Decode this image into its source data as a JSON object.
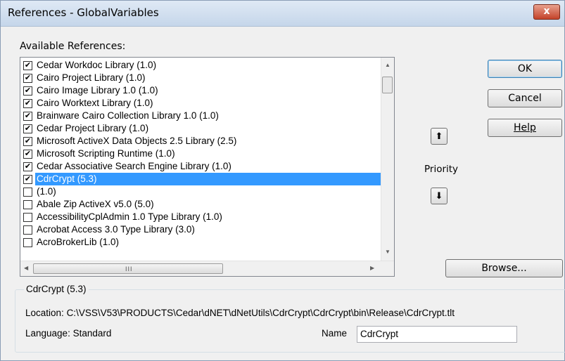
{
  "window": {
    "title": "References - GlobalVariables",
    "close_label": "x"
  },
  "available_label": "Available References:",
  "references": [
    {
      "label": "Cedar Workdoc Library (1.0)",
      "checked": true
    },
    {
      "label": "Cairo Project Library (1.0)",
      "checked": true
    },
    {
      "label": "Cairo Image Library 1.0 (1.0)",
      "checked": true
    },
    {
      "label": "Cairo Worktext Library (1.0)",
      "checked": true
    },
    {
      "label": "Brainware Cairo Collection Library 1.0 (1.0)",
      "checked": true
    },
    {
      "label": "Cedar Project Library (1.0)",
      "checked": true
    },
    {
      "label": "Microsoft ActiveX Data Objects 2.5 Library (2.5)",
      "checked": true
    },
    {
      "label": "Microsoft Scripting Runtime (1.0)",
      "checked": true
    },
    {
      "label": "Cedar Associative Search Engine Library (1.0)",
      "checked": true
    },
    {
      "label": "CdrCrypt (5.3)",
      "checked": true,
      "selected": true
    },
    {
      "label": "(1.0)",
      "checked": false
    },
    {
      "label": "Abale Zip ActiveX v5.0 (5.0)",
      "checked": false
    },
    {
      "label": "AccessibilityCplAdmin 1.0 Type Library (1.0)",
      "checked": false
    },
    {
      "label": "Acrobat Access 3.0 Type Library (3.0)",
      "checked": false
    },
    {
      "label": "AcroBrokerLib (1.0)",
      "checked": false
    }
  ],
  "buttons": {
    "ok": "OK",
    "cancel": "Cancel",
    "help": "Help",
    "browse": "Browse..."
  },
  "priority": {
    "label": "Priority",
    "up_icon": "arrow-up-icon",
    "down_icon": "arrow-down-icon"
  },
  "scroll_grip": "III",
  "details": {
    "group_title": "CdrCrypt (5.3)",
    "location_label": "Location:",
    "location_value": "C:\\VSS\\V53\\PRODUCTS\\Cedar\\dNET\\dNetUtils\\CdrCrypt\\CdrCrypt\\bin\\Release\\CdrCrypt.tlt",
    "language_label": "Language:",
    "language_value": "Standard",
    "name_label": "Name",
    "name_value": "CdrCrypt"
  },
  "colors": {
    "selection": "#3399ff",
    "dialog_bg": "#f0f0f0",
    "close_button": "#c4432a"
  }
}
